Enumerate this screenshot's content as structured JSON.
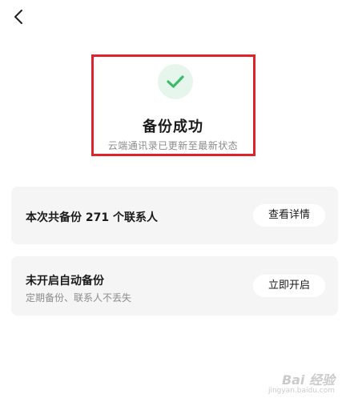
{
  "header": {
    "back_icon": "chevron-left-icon"
  },
  "status": {
    "icon": "check-icon",
    "title": "备份成功",
    "subtitle": "云端通讯录已更新至最新状态",
    "highlight_color": "#e0232b",
    "icon_color": "#3bbd6a"
  },
  "cards": [
    {
      "title": "本次共备份 271 个联系人",
      "button_label": "查看详情"
    },
    {
      "title": "未开启自动备份",
      "description": "定期备份、联系人不丢失",
      "button_label": "立即开启"
    }
  ],
  "watermark": {
    "logo": "Bai 经验",
    "url": "jingyan.baidu.com"
  }
}
